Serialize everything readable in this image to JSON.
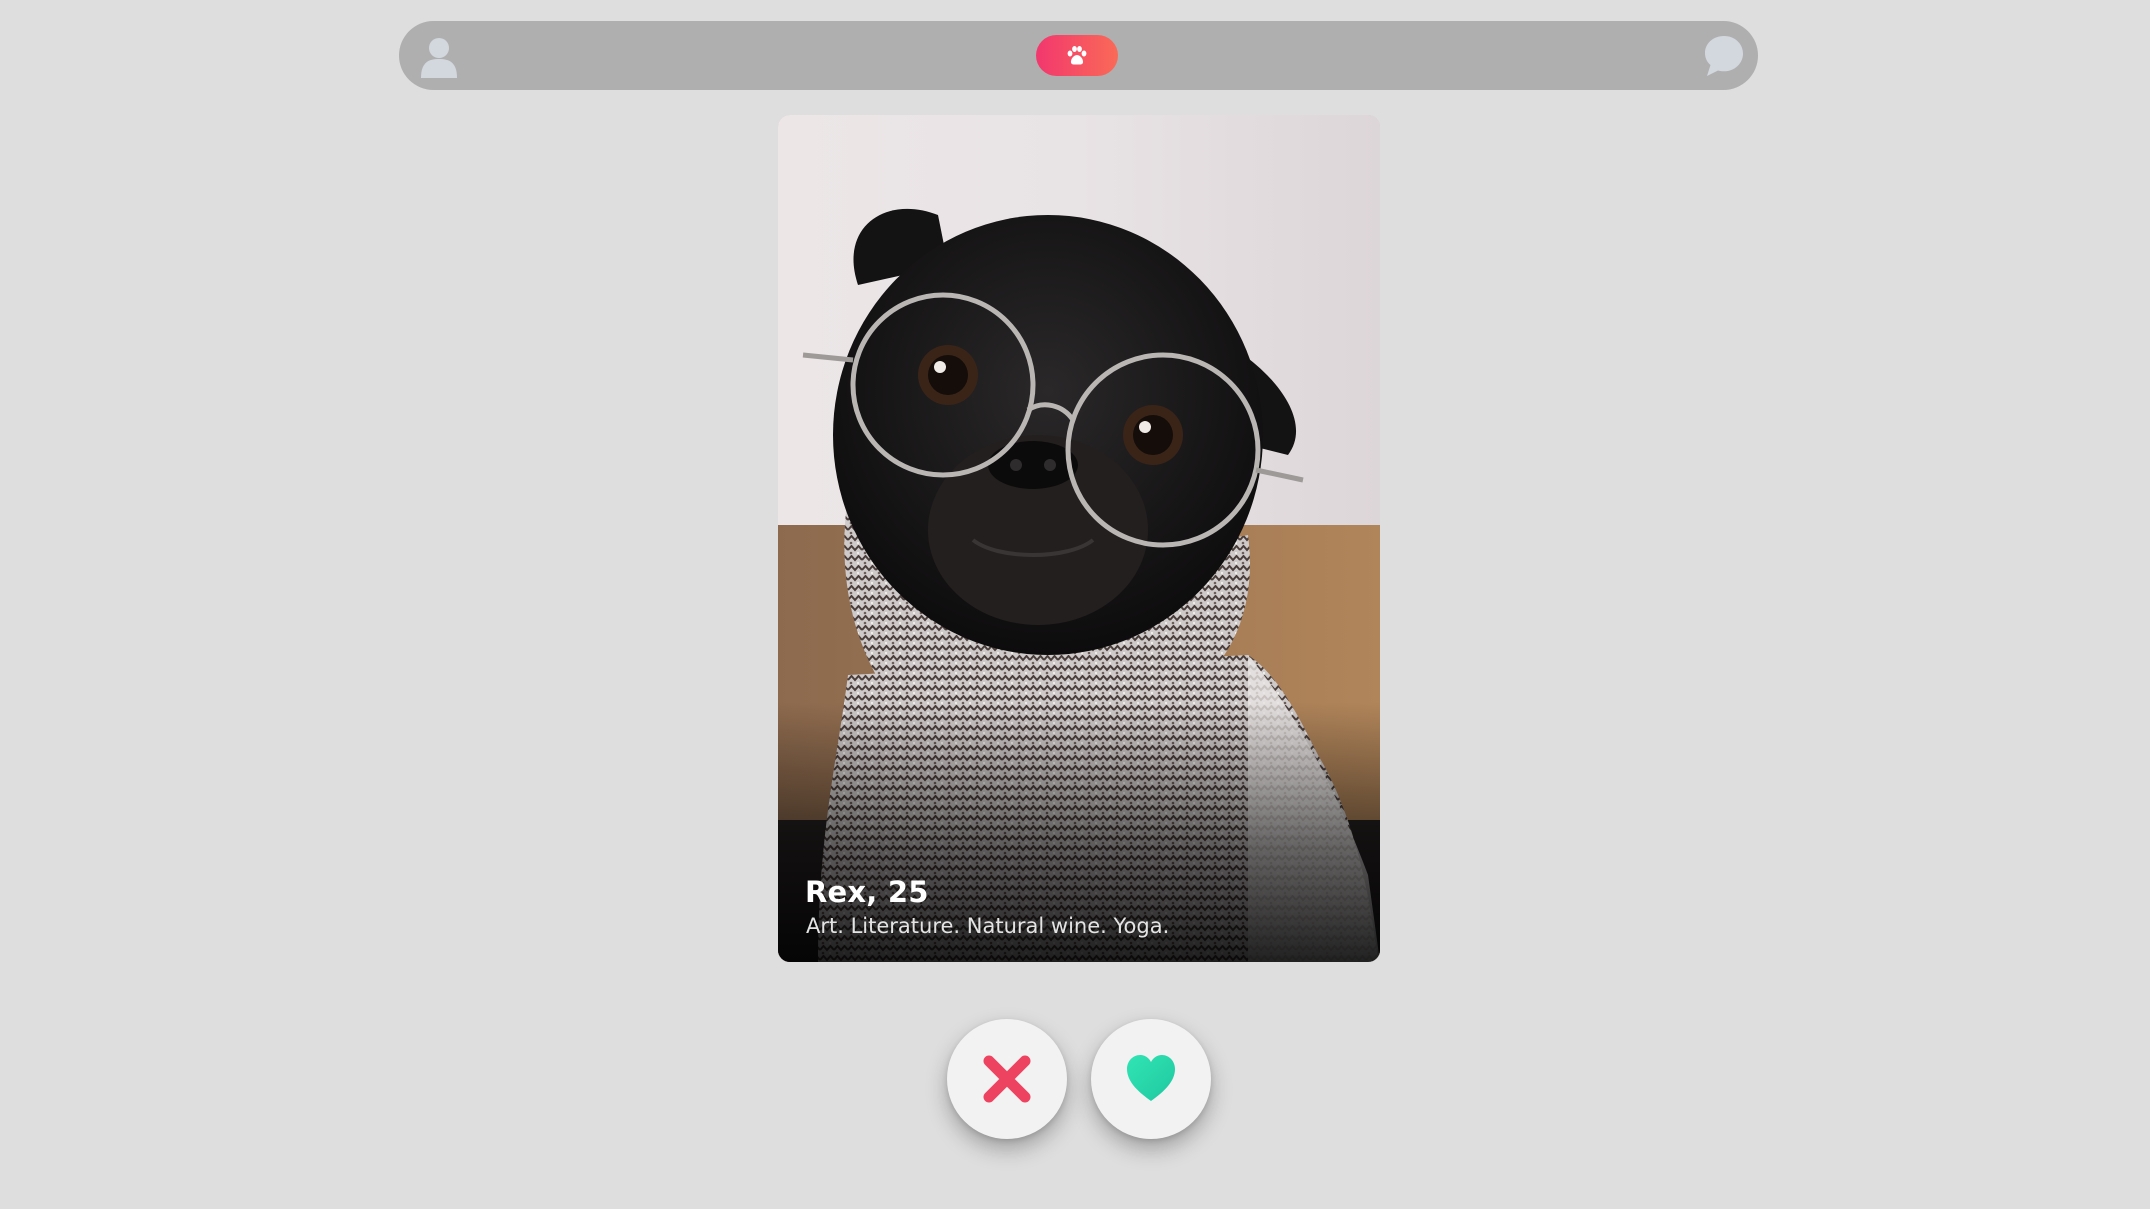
{
  "profile": {
    "name_age": "Rex, 25",
    "bio": "Art. Literature. Natural wine. Yoga."
  },
  "icons": {
    "profile": "user-icon",
    "home": "paw-icon",
    "chat": "chat-bubble-icon",
    "nope": "close-icon",
    "like": "heart-icon"
  },
  "colors": {
    "background": "#dedede",
    "topbar": "#afafaf",
    "icon_muted": "#d3d8de",
    "brand_start": "#f2376e",
    "brand_end": "#fa6a57",
    "nope": "#ee4360",
    "like": "#2ee0a8"
  }
}
